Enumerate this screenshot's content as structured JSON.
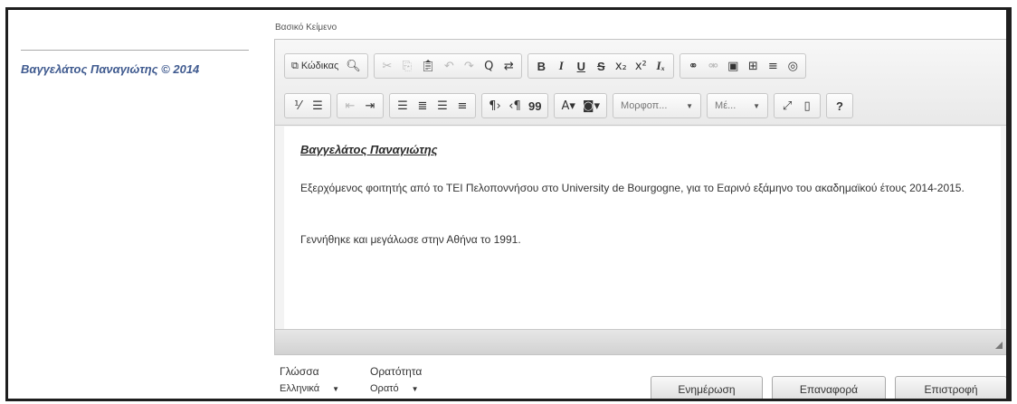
{
  "left_pane": {
    "copyright": "Βαγγελάτος Παναγιώτης © 2014"
  },
  "editor": {
    "title": "Βασικό Κείμενο",
    "toolbar": {
      "row1": [
        [
          {
            "icon": "source-icon",
            "glyph": "⧉",
            "label": "Κώδικας",
            "enabled": true
          },
          {
            "icon": "preview-icon",
            "glyph": "🔍︎",
            "enabled": true
          }
        ],
        [
          {
            "icon": "cut-icon",
            "glyph": "✂",
            "enabled": false
          },
          {
            "icon": "copy-icon",
            "glyph": "⎘",
            "enabled": false
          },
          {
            "icon": "paste-icon",
            "glyph": "📋︎",
            "enabled": true
          },
          {
            "icon": "undo-icon",
            "glyph": "↶",
            "enabled": false
          },
          {
            "icon": "redo-icon",
            "glyph": "↷",
            "enabled": false
          },
          {
            "icon": "find-icon",
            "glyph": "Q",
            "enabled": true
          },
          {
            "icon": "replace-icon",
            "glyph": "⇄",
            "enabled": true
          }
        ],
        [
          {
            "icon": "bold-icon",
            "glyph": "B",
            "style": "b",
            "enabled": true
          },
          {
            "icon": "italic-icon",
            "glyph": "I",
            "style": "i",
            "enabled": true
          },
          {
            "icon": "underline-icon",
            "glyph": "U",
            "style": "u",
            "enabled": true
          },
          {
            "icon": "strikethrough-icon",
            "glyph": "S",
            "style": "s",
            "enabled": true
          },
          {
            "icon": "subscript-icon",
            "glyph": "x₂",
            "enabled": true
          },
          {
            "icon": "superscript-icon",
            "glyph": "x²",
            "enabled": true
          },
          {
            "icon": "remove-format-icon",
            "glyph": "Iₓ",
            "style": "i",
            "enabled": true
          }
        ],
        [
          {
            "icon": "link-icon",
            "glyph": "⚭",
            "enabled": true
          },
          {
            "icon": "unlink-icon",
            "glyph": "⚮",
            "enabled": false
          },
          {
            "icon": "image-icon",
            "glyph": "▣",
            "enabled": true
          },
          {
            "icon": "table-icon",
            "glyph": "⊞",
            "enabled": true
          },
          {
            "icon": "horizontal-rule-icon",
            "glyph": "≡",
            "enabled": true
          },
          {
            "icon": "globe-icon",
            "glyph": "◎",
            "enabled": true
          }
        ]
      ],
      "row2": [
        [
          {
            "icon": "numbered-list-icon",
            "glyph": "⅟",
            "enabled": true
          },
          {
            "icon": "bulleted-list-icon",
            "glyph": "☰",
            "enabled": true
          }
        ],
        [
          {
            "icon": "outdent-icon",
            "glyph": "⇤",
            "enabled": false
          },
          {
            "icon": "indent-icon",
            "glyph": "⇥",
            "enabled": true
          }
        ],
        [
          {
            "icon": "align-left-icon",
            "glyph": "☰",
            "enabled": true
          },
          {
            "icon": "align-center-icon",
            "glyph": "≣",
            "enabled": true
          },
          {
            "icon": "align-right-icon",
            "glyph": "☰",
            "enabled": true
          },
          {
            "icon": "align-justify-icon",
            "glyph": "≡",
            "enabled": true
          }
        ],
        [
          {
            "icon": "ltr-icon",
            "glyph": "¶›",
            "enabled": true
          },
          {
            "icon": "rtl-icon",
            "glyph": "‹¶",
            "enabled": true
          },
          {
            "icon": "blockquote-icon",
            "glyph": "99",
            "style": "b",
            "enabled": true
          }
        ],
        [
          {
            "icon": "text-color-icon",
            "glyph": "A▾",
            "enabled": true
          },
          {
            "icon": "background-color-icon",
            "glyph": "◙▾",
            "enabled": true
          }
        ]
      ],
      "format_combo": "Μορφοπ...",
      "size_combo": "Μέ...",
      "row2_tail": [
        [
          {
            "icon": "maximize-icon",
            "glyph": "⤢",
            "enabled": true
          },
          {
            "icon": "show-blocks-icon",
            "glyph": "▯",
            "enabled": true
          }
        ],
        [
          {
            "icon": "help-icon",
            "glyph": "?",
            "style": "b",
            "enabled": true
          }
        ]
      ]
    },
    "content": {
      "heading": "Βαγγελάτος Παναγιώτης",
      "paragraph1": "Εξερχόμενος φοιτητής από το ΤΕΙ Πελοποννήσου στο University de Bourgogne, για το Εαρινό εξάμηνο του ακαδημαϊκού έτους 2014-2015.",
      "paragraph2": "Γεννήθηκε και μεγάλωσε στην Αθήνα το 1991."
    }
  },
  "form": {
    "language_label": "Γλώσσα",
    "language_value": "Ελληνικά",
    "visibility_label": "Ορατότητα",
    "visibility_value": "Ορατό"
  },
  "actions": {
    "update": "Ενημέρωση",
    "restore": "Επαναφορά",
    "back": "Επιστροφή"
  }
}
